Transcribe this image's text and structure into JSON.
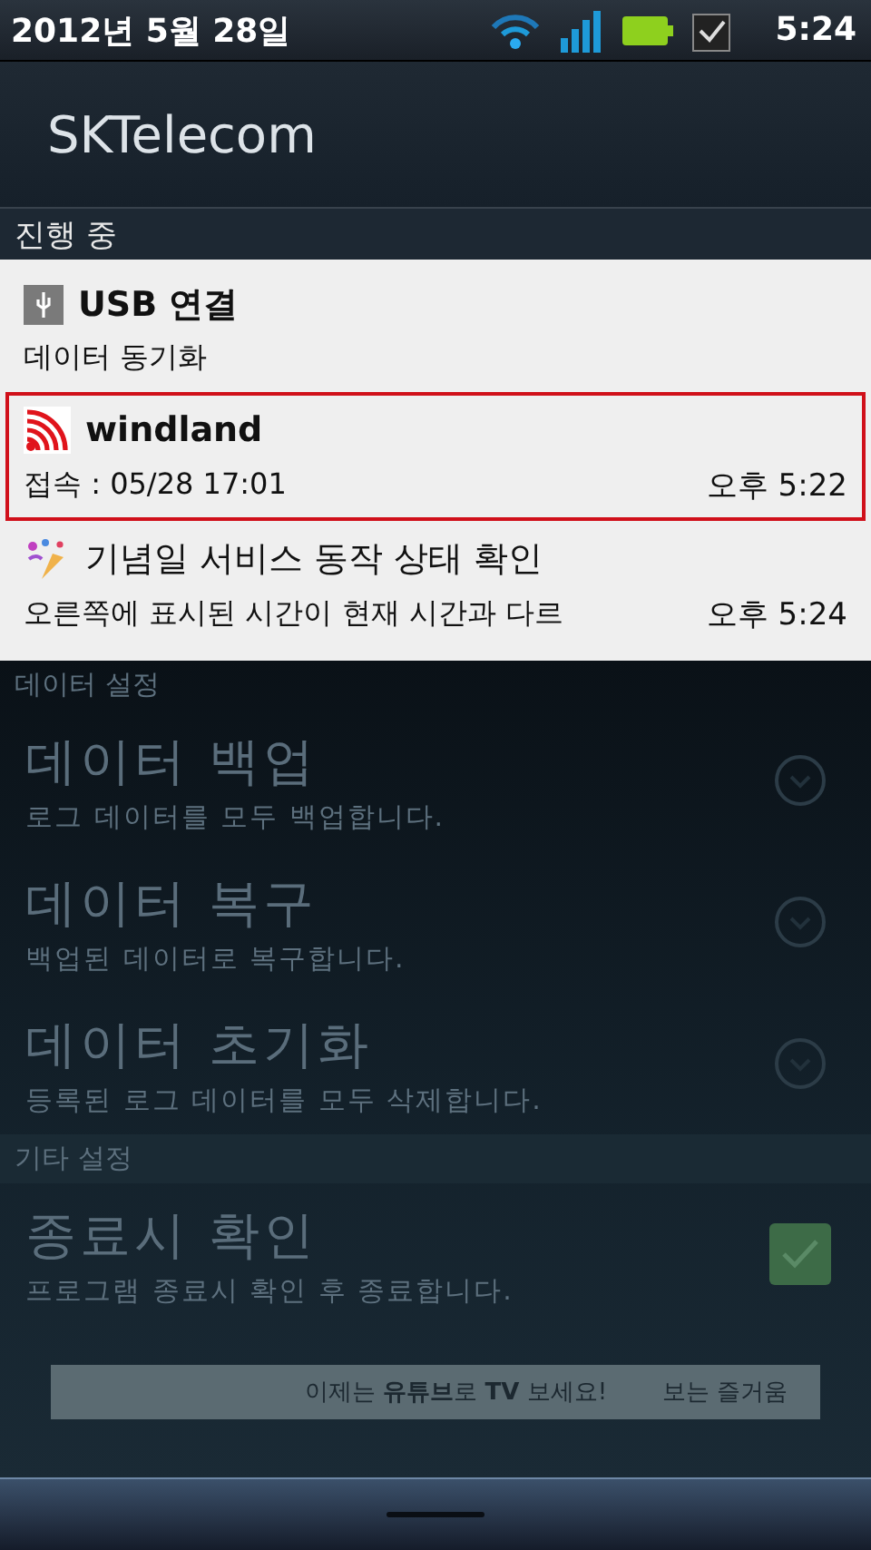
{
  "status_bar": {
    "date": "2012년 5월 28일",
    "time": "5:24"
  },
  "carrier": "SKTelecom",
  "section_label": "진행 중",
  "notifications": [
    {
      "kind": "usb",
      "title": "USB 연결",
      "text": "데이터 동기화",
      "selected": false
    },
    {
      "kind": "signal",
      "title": "windland",
      "text": "접속 : 05/28 17:01",
      "time": "오후 5:22",
      "selected": true
    },
    {
      "kind": "party",
      "title": "기념일 서비스 동작 상태 확인",
      "text": "오른쪽에 표시된 시간이 현재 시간과 다르",
      "time": "오후 5:24",
      "selected": false
    }
  ],
  "background_app": {
    "groups": [
      {
        "header": "데이터 설정",
        "items": [
          {
            "kind": "action",
            "title": "데이터 백업",
            "summary": "로그 데이터를 모두 백업합니다."
          },
          {
            "kind": "action",
            "title": "데이터 복구",
            "summary": "백업된 데이터로 복구합니다."
          },
          {
            "kind": "action",
            "title": "데이터 초기화",
            "summary": "등록된 로그 데이터를 모두 삭제합니다."
          }
        ]
      },
      {
        "header": "기타 설정",
        "items": [
          {
            "kind": "checkbox",
            "title": "종료시 확인",
            "summary": "프로그램 종료시 확인 후 종료합니다.",
            "checked": true
          }
        ]
      }
    ],
    "ad": {
      "headline": "이제는 **유튜브**로 **TV** 보세요!",
      "side": "보는 즐거움"
    }
  }
}
